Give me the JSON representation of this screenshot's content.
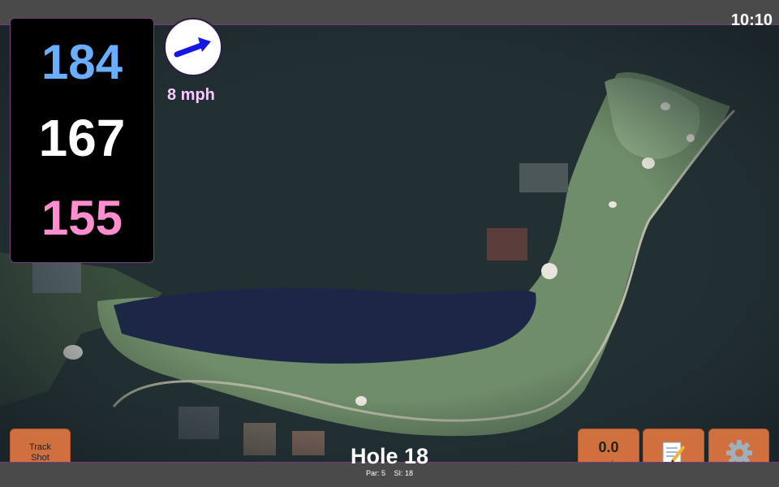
{
  "header": {
    "time": "10:10"
  },
  "distances": {
    "back": "184",
    "middle": "167",
    "front": "155"
  },
  "wind": {
    "speed_label": "8 mph",
    "icon": "wind-arrow-icon",
    "arrow_color": "#1515e6"
  },
  "buttons": {
    "track_shot_line1": "Track",
    "track_shot_line2": "Shot",
    "speed_value": "0.0",
    "speed_unit": "mph",
    "notes_icon": "memo-icon",
    "settings_icon": "gear-icon"
  },
  "hole": {
    "title": "Hole 18",
    "par": "Par: 5",
    "si": "SI: 18"
  },
  "colors": {
    "back": "#6aaeff",
    "middle": "#ffffff",
    "front": "#ff8dcf",
    "button": "#d0703f",
    "bar": "#4a4a4a",
    "border": "#7a3b7c"
  }
}
